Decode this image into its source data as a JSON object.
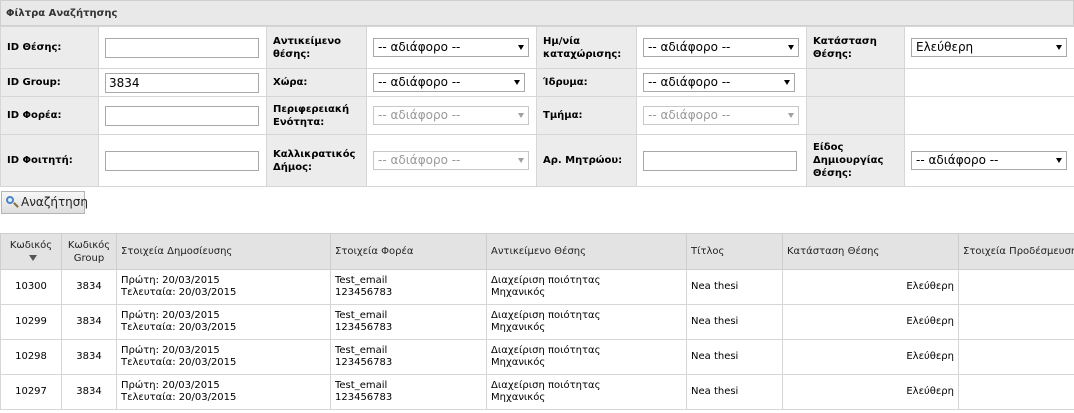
{
  "filters": {
    "title": "Φίλτρα Αναζήτησης",
    "id_thesis_label": "ID Θέσης:",
    "id_thesis_value": "",
    "antikeimeno_label": "Αντικείμενο θέσης:",
    "antikeimeno_value": "-- αδιάφορο --",
    "hmnia_label": "Ημ/νία καταχώρισης:",
    "hmnia_value": "-- αδιάφορο --",
    "katastasi_label": "Κατάσταση Θέσης:",
    "katastasi_value": "Ελεύθερη",
    "id_group_label": "ID Group:",
    "id_group_value": "3834",
    "xwra_label": "Χώρα:",
    "xwra_value": "-- αδιάφορο --",
    "idryma_label": "Ίδρυμα:",
    "idryma_value": "-- αδιάφορο --",
    "id_forea_label": "ID Φορέα:",
    "id_forea_value": "",
    "perifereia_label": "Περιφερειακή Ενότητα:",
    "perifereia_value": "-- αδιάφορο --",
    "tmima_label": "Τμήμα:",
    "tmima_value": "-- αδιάφορο --",
    "id_foititi_label": "ID Φοιτητή:",
    "id_foititi_value": "",
    "dimos_label": "Καλλικρατικός Δήμος:",
    "dimos_value": "-- αδιάφορο --",
    "mitroo_label": "Αρ. Μητρώου:",
    "mitroo_value": "",
    "eidos_label": "Είδος Δημιουργίας Θέσης:",
    "eidos_value": "-- αδιάφορο --"
  },
  "search_button": {
    "label": "Αναζήτηση",
    "icon": "magnifier-icon"
  },
  "results": {
    "columns": [
      "Κωδικός",
      "Κωδικός Group",
      "Στοιχεία Δημοσίευσης",
      "Στοιχεία Φορέα",
      "Αντικείμενο Θέσης",
      "Τίτλος",
      "Κατάσταση Θέσης",
      "Στοιχεία Προδέσμευσης"
    ],
    "rows": [
      {
        "code": "10300",
        "group": "3834",
        "pub1": "Πρώτη: 20/03/2015",
        "pub2": "Τελευταία: 20/03/2015",
        "forea1": "Test_email",
        "forea2": "123456783",
        "obj1": "Διαχείριση ποιότητας",
        "obj2": "Μηχανικός",
        "title": "Nea thesi",
        "status": "Ελεύθερη",
        "prodesmeusi": ""
      },
      {
        "code": "10299",
        "group": "3834",
        "pub1": "Πρώτη: 20/03/2015",
        "pub2": "Τελευταία: 20/03/2015",
        "forea1": "Test_email",
        "forea2": "123456783",
        "obj1": "Διαχείριση ποιότητας",
        "obj2": "Μηχανικός",
        "title": "Nea thesi",
        "status": "Ελεύθερη",
        "prodesmeusi": ""
      },
      {
        "code": "10298",
        "group": "3834",
        "pub1": "Πρώτη: 20/03/2015",
        "pub2": "Τελευταία: 20/03/2015",
        "forea1": "Test_email",
        "forea2": "123456783",
        "obj1": "Διαχείριση ποιότητας",
        "obj2": "Μηχανικός",
        "title": "Nea thesi",
        "status": "Ελεύθερη",
        "prodesmeusi": ""
      },
      {
        "code": "10297",
        "group": "3834",
        "pub1": "Πρώτη: 20/03/2015",
        "pub2": "Τελευταία: 20/03/2015",
        "forea1": "Test_email",
        "forea2": "123456783",
        "obj1": "Διαχείριση ποιότητας",
        "obj2": "Μηχανικός",
        "title": "Nea thesi",
        "status": "Ελεύθερη",
        "prodesmeusi": ""
      }
    ]
  }
}
